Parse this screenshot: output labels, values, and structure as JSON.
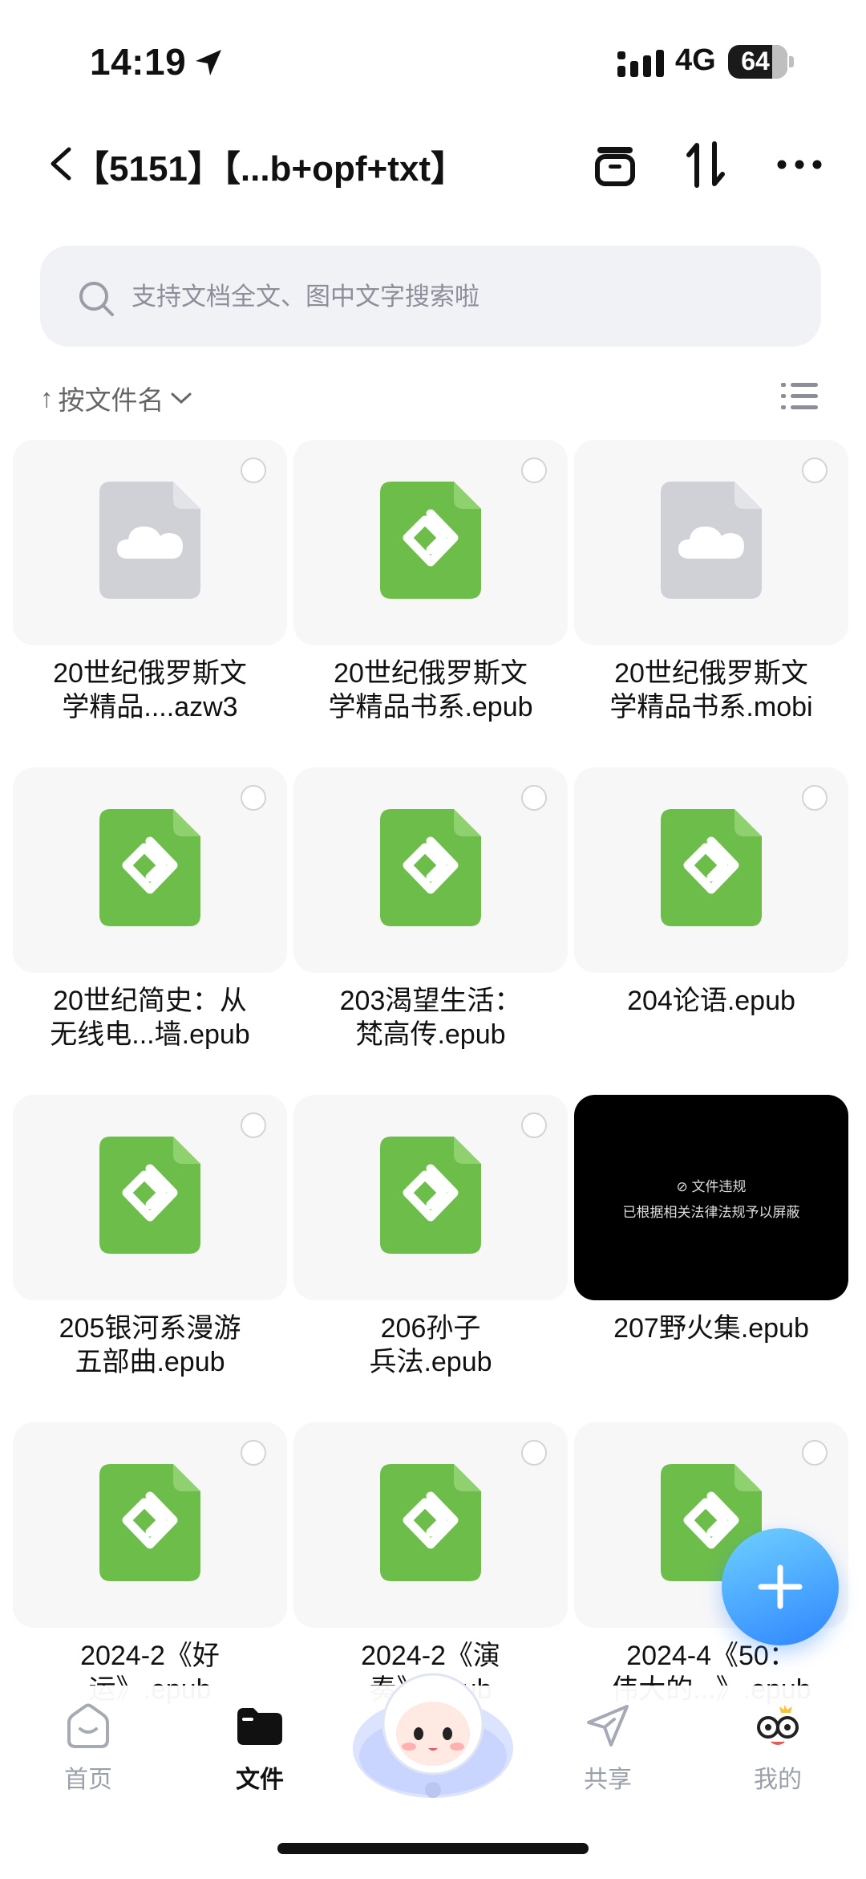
{
  "status_bar": {
    "time": "14:19",
    "network": "4G",
    "battery": "64"
  },
  "nav": {
    "title": "【5151】【...b+opf+txt】"
  },
  "search": {
    "placeholder": "支持文档全文、图中文字搜索啦"
  },
  "sort": {
    "arrow": "↑",
    "label": "按文件名"
  },
  "files": [
    {
      "name_line1": "20世纪俄罗斯文",
      "name_line2": "学精品....azw3",
      "type": "cloud"
    },
    {
      "name_line1": "20世纪俄罗斯文",
      "name_line2": "学精品书系.epub",
      "type": "epub"
    },
    {
      "name_line1": "20世纪俄罗斯文",
      "name_line2": "学精品书系.mobi",
      "type": "cloud"
    },
    {
      "name_line1": "20世纪简史：从",
      "name_line2": "无线电...墙.epub",
      "type": "epub"
    },
    {
      "name_line1": "203渴望生活：",
      "name_line2": "梵高传.epub",
      "type": "epub"
    },
    {
      "name_line1": "204论语.epub",
      "name_line2": "",
      "type": "epub"
    },
    {
      "name_line1": "205银河系漫游",
      "name_line2": "五部曲.epub",
      "type": "epub"
    },
    {
      "name_line1": "206孙子",
      "name_line2": "兵法.epub",
      "type": "epub"
    },
    {
      "name_line1": "207野火集.epub",
      "name_line2": "",
      "type": "blocked",
      "blocked_title": "文件违规",
      "blocked_desc": "已根据相关法律法规予以屏蔽"
    },
    {
      "name_line1": "2024-2《好",
      "name_line2": "运》.epub",
      "type": "epub"
    },
    {
      "name_line1": "2024-2《演",
      "name_line2": "奏》.epub",
      "type": "epub"
    },
    {
      "name_line1": "2024-4《50：",
      "name_line2": "伟大的...》.epub",
      "type": "epub"
    }
  ],
  "tabs": [
    {
      "label": "首页",
      "icon": "home-icon"
    },
    {
      "label": "文件",
      "icon": "folder-icon"
    },
    {
      "label": "共享",
      "icon": "share-icon"
    },
    {
      "label": "我的",
      "icon": "profile-icon"
    }
  ],
  "colors": {
    "epub_green": "#6cbd4a",
    "cloud_gray": "#cfd1d6",
    "fab_blue": "#3f96ff"
  }
}
